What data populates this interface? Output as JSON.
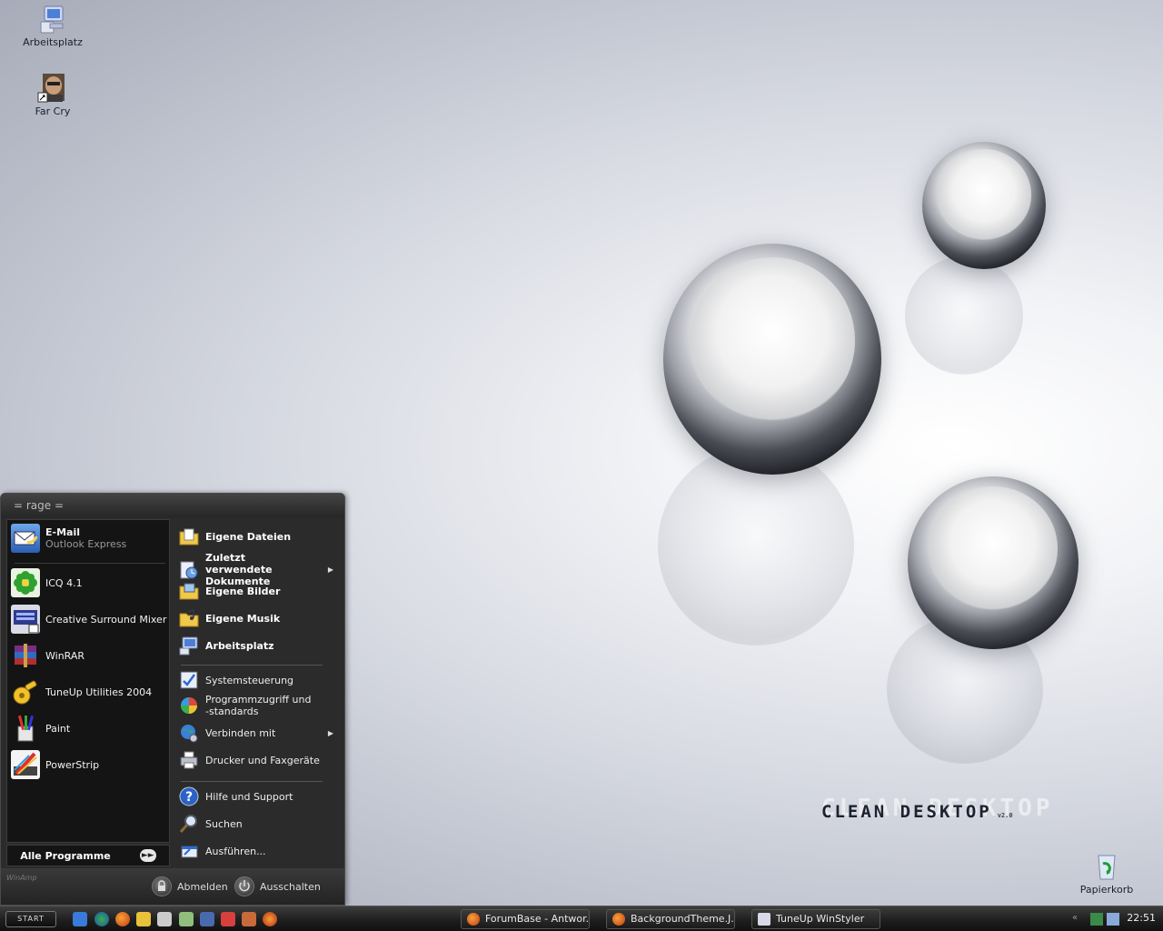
{
  "desktop": {
    "icons": [
      {
        "label": "Arbeitsplatz",
        "icon": "my-computer-icon"
      },
      {
        "label": "Far Cry",
        "icon": "far-cry-icon"
      },
      {
        "label": "Papierkorb",
        "icon": "recycle-bin-icon"
      }
    ],
    "wallpaper": {
      "logo_text": "CLEAN DESKTOP",
      "logo_ghost_text": "CLEAN DESKTOP",
      "logo_version": "v2.0"
    }
  },
  "start_menu": {
    "user_name": "= rage =",
    "pinned": [
      {
        "title": "E-Mail",
        "subtitle": "Outlook Express",
        "icon": "email-icon"
      }
    ],
    "recent": [
      {
        "label": "ICQ 4.1",
        "icon": "icq-icon"
      },
      {
        "label": "Creative Surround Mixer",
        "icon": "surround-mixer-icon"
      },
      {
        "label": "WinRAR",
        "icon": "winrar-icon"
      },
      {
        "label": "TuneUp Utilities 2004",
        "icon": "tuneup-icon"
      },
      {
        "label": "Paint",
        "icon": "paint-icon"
      },
      {
        "label": "PowerStrip",
        "icon": "powerstrip-icon"
      }
    ],
    "all_programs": "Alle Programme",
    "places": [
      {
        "label": "Eigene Dateien",
        "icon": "my-documents-icon"
      },
      {
        "label": "Zuletzt verwendete Dokumente",
        "icon": "recent-documents-icon"
      },
      {
        "label": "Eigene Bilder",
        "icon": "my-pictures-icon"
      },
      {
        "label": "Eigene Musik",
        "icon": "my-music-icon"
      },
      {
        "label": "Arbeitsplatz",
        "icon": "my-computer-icon"
      }
    ],
    "system": [
      {
        "label": "Systemsteuerung",
        "icon": "control-panel-icon"
      },
      {
        "label": "Programmzugriff und -standards",
        "icon": "program-defaults-icon"
      },
      {
        "label": "Verbinden mit",
        "icon": "connect-to-icon"
      },
      {
        "label": "Drucker und Faxgeräte",
        "icon": "printers-icon"
      }
    ],
    "help": [
      {
        "label": "Hilfe und Support",
        "icon": "help-icon"
      },
      {
        "label": "Suchen",
        "icon": "search-icon"
      },
      {
        "label": "Ausführen...",
        "icon": "run-icon"
      }
    ],
    "footer": {
      "logoff": "Abmelden",
      "shutdown": "Ausschalten",
      "winamp_logo": "WinAmp"
    }
  },
  "taskbar": {
    "start_label": "START",
    "quick_launch": [
      "ie-icon",
      "globe-icon",
      "firefox-icon",
      "lightning-icon",
      "steam-icon",
      "alien-icon",
      "thunderbird-icon",
      "pdf-icon",
      "utility-icon",
      "firefox-alt-icon"
    ],
    "tasks": [
      {
        "label": "ForumBase - Antwor...",
        "icon": "firefox-icon"
      },
      {
        "label": "BackgroundTheme.J...",
        "icon": "firefox-icon"
      },
      {
        "label": "TuneUp WinStyler",
        "icon": "tuneup-winstyler-icon"
      }
    ],
    "clock": "22:51"
  }
}
